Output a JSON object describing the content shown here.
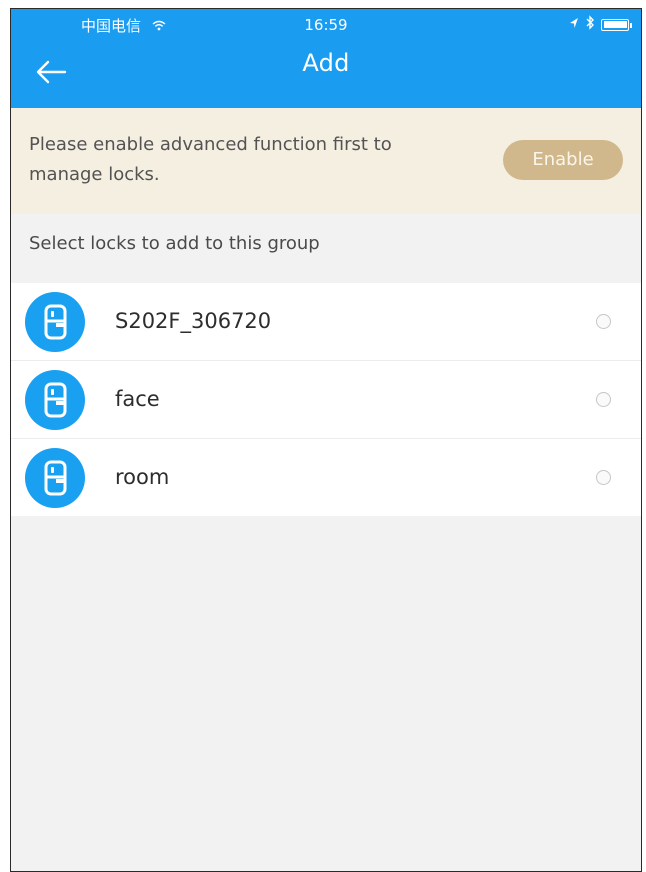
{
  "status_bar": {
    "carrier": "中国电信",
    "time": "16:59",
    "icons": [
      "wifi-icon",
      "location-arrow-icon",
      "bluetooth-icon",
      "battery-icon"
    ]
  },
  "header": {
    "title": "Add",
    "back_icon": "back-arrow-icon"
  },
  "notice": {
    "text": "Please enable advanced function first to manage locks.",
    "button_label": "Enable"
  },
  "section": {
    "header": "Select locks to add to this group"
  },
  "locks": [
    {
      "name": "S202F_306720",
      "icon": "door-lock-icon",
      "selected": false
    },
    {
      "name": "face",
      "icon": "door-lock-icon",
      "selected": false
    },
    {
      "name": "room",
      "icon": "door-lock-icon",
      "selected": false
    }
  ],
  "colors": {
    "primary": "#1a9cf0",
    "notice_background": "#f5efe2",
    "enable_button": "#d0b88c",
    "page_background": "#f2f2f2"
  }
}
